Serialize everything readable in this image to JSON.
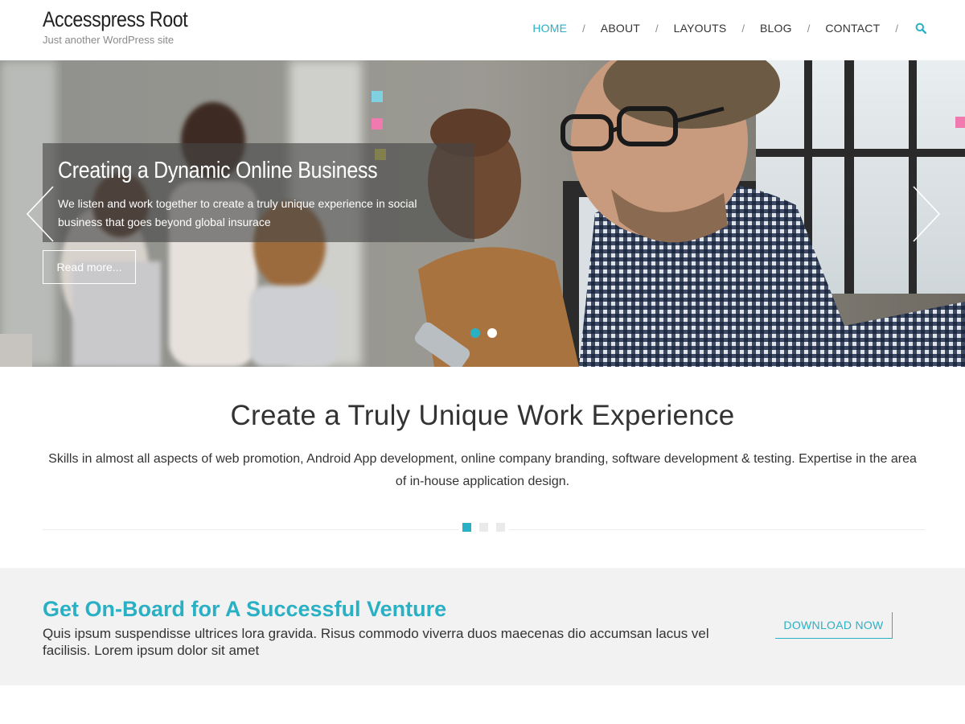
{
  "site": {
    "title": "Accesspress Root",
    "tagline": "Just another WordPress site"
  },
  "nav": {
    "items": [
      {
        "label": "HOME",
        "active": true
      },
      {
        "label": "ABOUT"
      },
      {
        "label": "LAYOUTS"
      },
      {
        "label": "BLOG"
      },
      {
        "label": "CONTACT"
      }
    ],
    "separator": "/",
    "search_icon": "search-icon"
  },
  "hero": {
    "title": "Creating a Dynamic Online Business",
    "text": "We listen and work together to create a truly unique experience in social business that goes beyond global insurace",
    "button": "Read more...",
    "prev_icon": "chevron-left-icon",
    "next_icon": "chevron-right-icon",
    "slide_count": 2,
    "active_slide": 1
  },
  "intro": {
    "title": "Create a Truly Unique Work Experience",
    "text": "Skills in almost all aspects of web promotion, Android App development, online company branding, software development & testing. Expertise in the area of in-house application design.",
    "page_count": 3,
    "active_page": 1
  },
  "cta": {
    "title": "Get On-Board for A Successful Venture",
    "text": "Quis ipsum suspendisse ultrices lora gravida. Risus commodo viverra duos maecenas dio accumsan lacus vel facilisis. Lorem ipsum dolor sit amet",
    "button": "DOWNLOAD NOW"
  },
  "colors": {
    "accent": "#2ab0c4",
    "cta_background": "#f2f2f2"
  }
}
